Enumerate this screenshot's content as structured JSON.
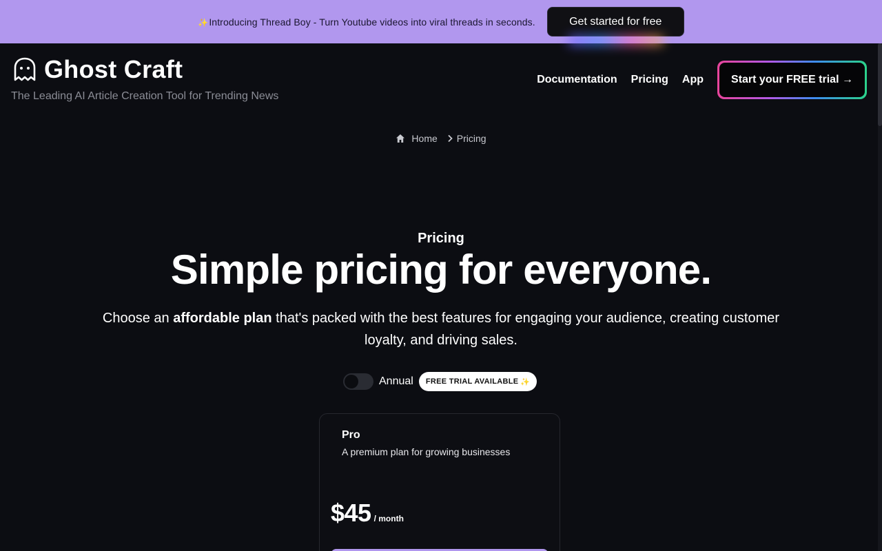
{
  "banner": {
    "sparkle": "✨",
    "text": "Introducing Thread Boy - Turn Youtube videos into viral threads in seconds.",
    "button_label": "Get started for free"
  },
  "header": {
    "logo_text": "Ghost Craft",
    "tagline": "The Leading AI Article Creation Tool for Trending News",
    "nav": [
      {
        "label": "Documentation"
      },
      {
        "label": "Pricing"
      },
      {
        "label": "App"
      }
    ],
    "cta_label": "Start your FREE trial →"
  },
  "breadcrumb": {
    "home": "Home",
    "current": "Pricing"
  },
  "hero": {
    "eyebrow": "Pricing",
    "headline": "Simple pricing for everyone.",
    "subhead_pre": "Choose an ",
    "subhead_bold": "affordable plan",
    "subhead_post": " that's packed with the best features for engaging your audience, creating customer loyalty, and driving sales."
  },
  "billing": {
    "toggle_label": "Annual",
    "annual_enabled": false,
    "badge": "FREE TRIAL AVAILABLE",
    "badge_sparkle": "✨"
  },
  "plan": {
    "name": "Pro",
    "description": "A premium plan for growing businesses",
    "price": "$45",
    "period": "/ month"
  },
  "colors": {
    "background": "#0c0d12",
    "banner": "#b197ee",
    "accent": "#b197ee"
  }
}
